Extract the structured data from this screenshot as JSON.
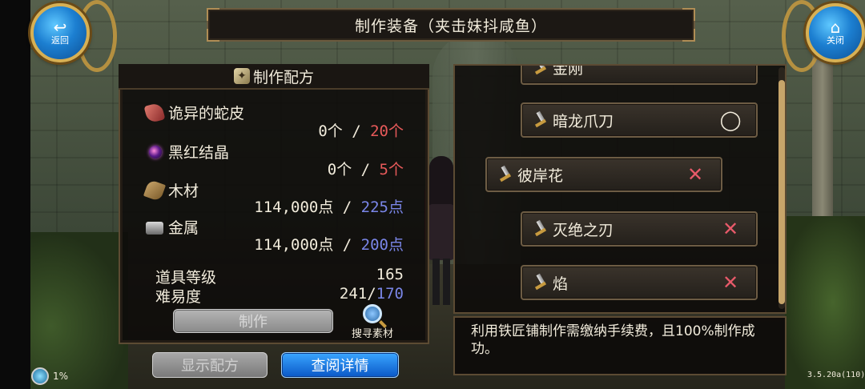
{
  "window": {
    "title": "制作装备（夹击妹抖咸鱼）"
  },
  "nav": {
    "back_label": "返回",
    "back_icon": "return-arrow-icon",
    "close_label": "关闭",
    "close_icon": "home-icon"
  },
  "recipe": {
    "header": "制作配方",
    "materials": [
      {
        "name": "诡异的蛇皮",
        "icon": "snake-skin-icon",
        "have": "0个",
        "sep": " / ",
        "need": "20个",
        "need_color": "#e85a5a"
      },
      {
        "name": "黑红结晶",
        "icon": "crystal-icon",
        "have": "0个",
        "sep": " / ",
        "need": "5个",
        "need_color": "#e85a5a"
      },
      {
        "name": "木材",
        "icon": "wood-icon",
        "have": "114,000点",
        "sep": " / ",
        "need": "225点",
        "need_color": "#7a86e8"
      },
      {
        "name": "金属",
        "icon": "metal-icon",
        "have": "114,000点",
        "sep": " / ",
        "need": "200点",
        "need_color": "#7a86e8"
      }
    ],
    "item_level_label": "道具等级",
    "item_level_value": "165",
    "difficulty_label": "难易度",
    "difficulty_value": "241/",
    "difficulty_target": "170",
    "make_button": "制作",
    "search_material": "搜寻素材",
    "show_recipe_button": "显示配方",
    "view_detail_button": "查阅详情"
  },
  "equipment_list": {
    "items": [
      {
        "name": "金刚",
        "status": "^"
      },
      {
        "name": "暗龙爪刀",
        "status": "◯"
      },
      {
        "name": "彼岸花",
        "status": "✕"
      },
      {
        "name": "灭绝之刃",
        "status": "✕"
      },
      {
        "name": "焰",
        "status": "✕"
      }
    ]
  },
  "description": "利用铁匠铺制作需缴纳手续费，且100%制作成功。",
  "status": {
    "percent": "1%",
    "version": "3.5.20a(110)"
  },
  "colors": {
    "accent_blue": "#0a58c8",
    "gold_frame": "#c79a3f",
    "warn_red": "#e85a5a"
  }
}
